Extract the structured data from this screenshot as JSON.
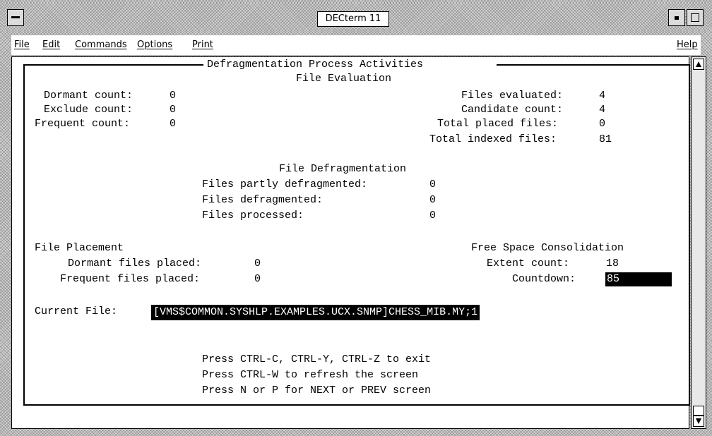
{
  "window": {
    "title": "DECterm 11"
  },
  "menubar": {
    "items": [
      {
        "label": "File"
      },
      {
        "label": "Edit"
      },
      {
        "label": "Commands"
      },
      {
        "label": "Options"
      },
      {
        "label": "Print"
      }
    ],
    "help": "Help"
  },
  "screen": {
    "heading": "Defragmentation Process Activities",
    "file_evaluation": {
      "title": "File Evaluation",
      "dormant_count": {
        "label": "Dormant count:",
        "value": "0"
      },
      "exclude_count": {
        "label": "Exclude count:",
        "value": "0"
      },
      "frequent_count": {
        "label": "Frequent count:",
        "value": "0"
      },
      "files_evaluated": {
        "label": "Files evaluated:",
        "value": "4"
      },
      "candidate_count": {
        "label": "Candidate count:",
        "value": "4"
      },
      "total_placed_files": {
        "label": "Total placed files:",
        "value": "0"
      },
      "total_indexed_files": {
        "label": "Total indexed files:",
        "value": "81"
      }
    },
    "file_defragmentation": {
      "title": "File Defragmentation",
      "partly_defragmented": {
        "label": "Files partly defragmented:",
        "value": "0"
      },
      "defragmented": {
        "label": "Files defragmented:",
        "value": "0"
      },
      "processed": {
        "label": "Files processed:",
        "value": "0"
      }
    },
    "file_placement": {
      "title": "File Placement",
      "dormant_placed": {
        "label": "Dormant files placed:",
        "value": "0"
      },
      "frequent_placed": {
        "label": "Frequent files placed:",
        "value": "0"
      }
    },
    "free_space": {
      "title": "Free Space Consolidation",
      "extent_count": {
        "label": "Extent count:",
        "value": "18"
      },
      "countdown": {
        "label": "Countdown:",
        "value": "85"
      }
    },
    "current_file": {
      "label": "Current File:",
      "value": "[VMS$COMMON.SYSHLP.EXAMPLES.UCX.SNMP]CHESS_MIB.MY;1"
    },
    "instructions": [
      "Press CTRL-C, CTRL-Y, CTRL-Z to exit",
      "Press CTRL-W to refresh the screen",
      "Press N or P for NEXT or PREV screen"
    ]
  },
  "icons": {
    "window_menu": "window-menu-icon",
    "minimize": "minimize-icon",
    "maximize": "maximize-icon",
    "scroll_up": "arrow-up-icon",
    "scroll_down": "arrow-down-icon"
  }
}
